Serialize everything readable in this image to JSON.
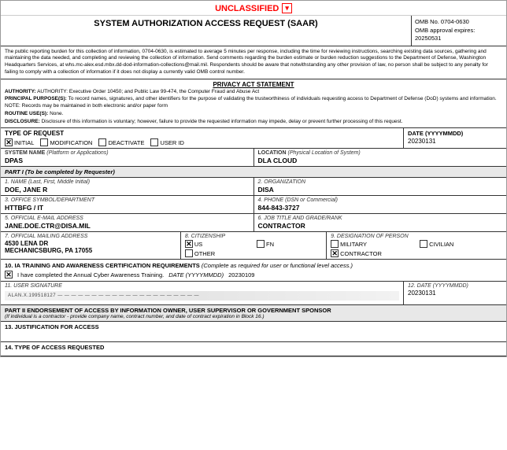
{
  "page": {
    "unclassified_label": "UNCLASSIFIED",
    "title": "SYSTEM AUTHORIZATION ACCESS REQUEST (SAAR)",
    "omb": {
      "label": "OMB No. 0704-0630",
      "approval_label": "OMB approval expires:",
      "approval_date": "20250531"
    },
    "preamble": "The public reporting burden for this collection of information, 0704-0630, is estimated to average 5 minutes per response, including the time for reviewing instructions, searching existing data sources, gathering and maintaining the data needed, and completing and reviewing the collection of information. Send comments regarding the burden estimate or burden reduction suggestions to the Department of Defense, Washington Headquarters Services, at whs.mc-alex.esd.mbx.dd-dod-information-collections@mail.mil. Respondents should be aware that notwithstanding any other provision of law, no person shall be subject to any penalty for failing to comply with a collection of information if it does not display a currently valid OMB control number.",
    "privacy": {
      "title": "PRIVACY ACT STATEMENT",
      "authority": "AUTHORITY: Executive Order 10450; and Public Law 99-474, the Computer Fraud and Abuse Act",
      "principal": "PRINCIPAL PURPOSE(S): To record names, signatures, and other identifiers for the purpose of validating the trustworthiness of individuals requesting access to Department of Defense (DoD) systems and information. NOTE: Records may be maintained in both electronic and/or paper form",
      "routine": "ROUTINE USE(S): None.",
      "disclosure": "DISCLOSURE: Disclosure of this information is voluntary; however, failure to provide the requested information may impede, delay or prevent further processing of this request."
    },
    "type_of_request": {
      "label": "TYPE OF REQUEST",
      "initial": {
        "label": "INITIAL",
        "checked": true
      },
      "modification": {
        "label": "MODIFICATION",
        "checked": false
      },
      "deactivate": {
        "label": "DEACTIVATE",
        "checked": false
      },
      "user_id": {
        "label": "USER ID",
        "checked": false
      }
    },
    "date_label": "DATE (YYYYMMDD)",
    "date_value": "20230131",
    "system_name": {
      "label": "SYSTEM NAME (Platform or Applications)",
      "value": "DPAS"
    },
    "location": {
      "label": "LOCATION (Physical Location of System)",
      "value": "DLA CLOUD"
    },
    "part1_label": "PART I (To be completed by Requester)",
    "fields": {
      "name": {
        "label": "1. NAME (Last, First, Middle Initial)",
        "value": "DOE, JANE R"
      },
      "organization": {
        "label": "2. ORGANIZATION",
        "value": "DISA"
      },
      "office_symbol": {
        "label": "3. OFFICE SYMBOL/DEPARTMENT",
        "value": "HTTBFG / IT"
      },
      "phone": {
        "label": "4. PHONE (DSN or Commercial)",
        "value": "844-843-3727"
      },
      "email": {
        "label": "5. OFFICIAL E-MAIL ADDRESS",
        "value": "JANE.DOE.CTR@DISA.MIL"
      },
      "job_title": {
        "label": "6. JOB TITLE AND GRADE/RANK",
        "value": "CONTRACTOR"
      },
      "mailing_address": {
        "label": "7. OFFICIAL MAILING ADDRESS",
        "value": "4530 LENA DR\nMECHANICSBURG, PA 17055"
      },
      "citizenship": {
        "label": "8. CITIZENSHIP",
        "us": {
          "label": "US",
          "checked": true
        },
        "fn": {
          "label": "FN",
          "checked": false
        },
        "other": {
          "label": "OTHER",
          "checked": false
        }
      },
      "designation": {
        "label": "9. DESIGNATION OF PERSON",
        "military": {
          "label": "MILITARY",
          "checked": false
        },
        "civilian": {
          "label": "CIVILIAN",
          "checked": false
        },
        "contractor": {
          "label": "CONTRACTOR",
          "checked": true
        }
      }
    },
    "training": {
      "label": "10. IA TRAINING AND AWARENESS CERTIFICATION REQUIREMENTS",
      "sublabel": "(Complete as required for user or functional level access.)",
      "item": "I have completed the Annual Cyber Awareness Training.",
      "checked": true,
      "date_label": "DATE (YYYYMMDD)",
      "date_value": "20230109"
    },
    "signature": {
      "label": "11. USER SIGNATURE",
      "sig_text": "ALAN.X.199518127 — — — — — — — — — — — — — — — — — — — — —"
    },
    "sig_date": {
      "label": "12. DATE (YYYYMMDD)",
      "value": "20230131"
    },
    "part2": {
      "label": "PART II ENDORSEMENT OF ACCESS BY INFORMATION OWNER, USER SUPERVISOR OR GOVERNMENT SPONSOR",
      "sublabel": "(If individual is a contractor - provide company name, contract number, and date of contract expiration in Block 16.)"
    },
    "section13": {
      "label": "13. JUSTIFICATION FOR ACCESS"
    },
    "section14": {
      "label": "14. TYPE OF ACCESS REQUESTED"
    }
  }
}
